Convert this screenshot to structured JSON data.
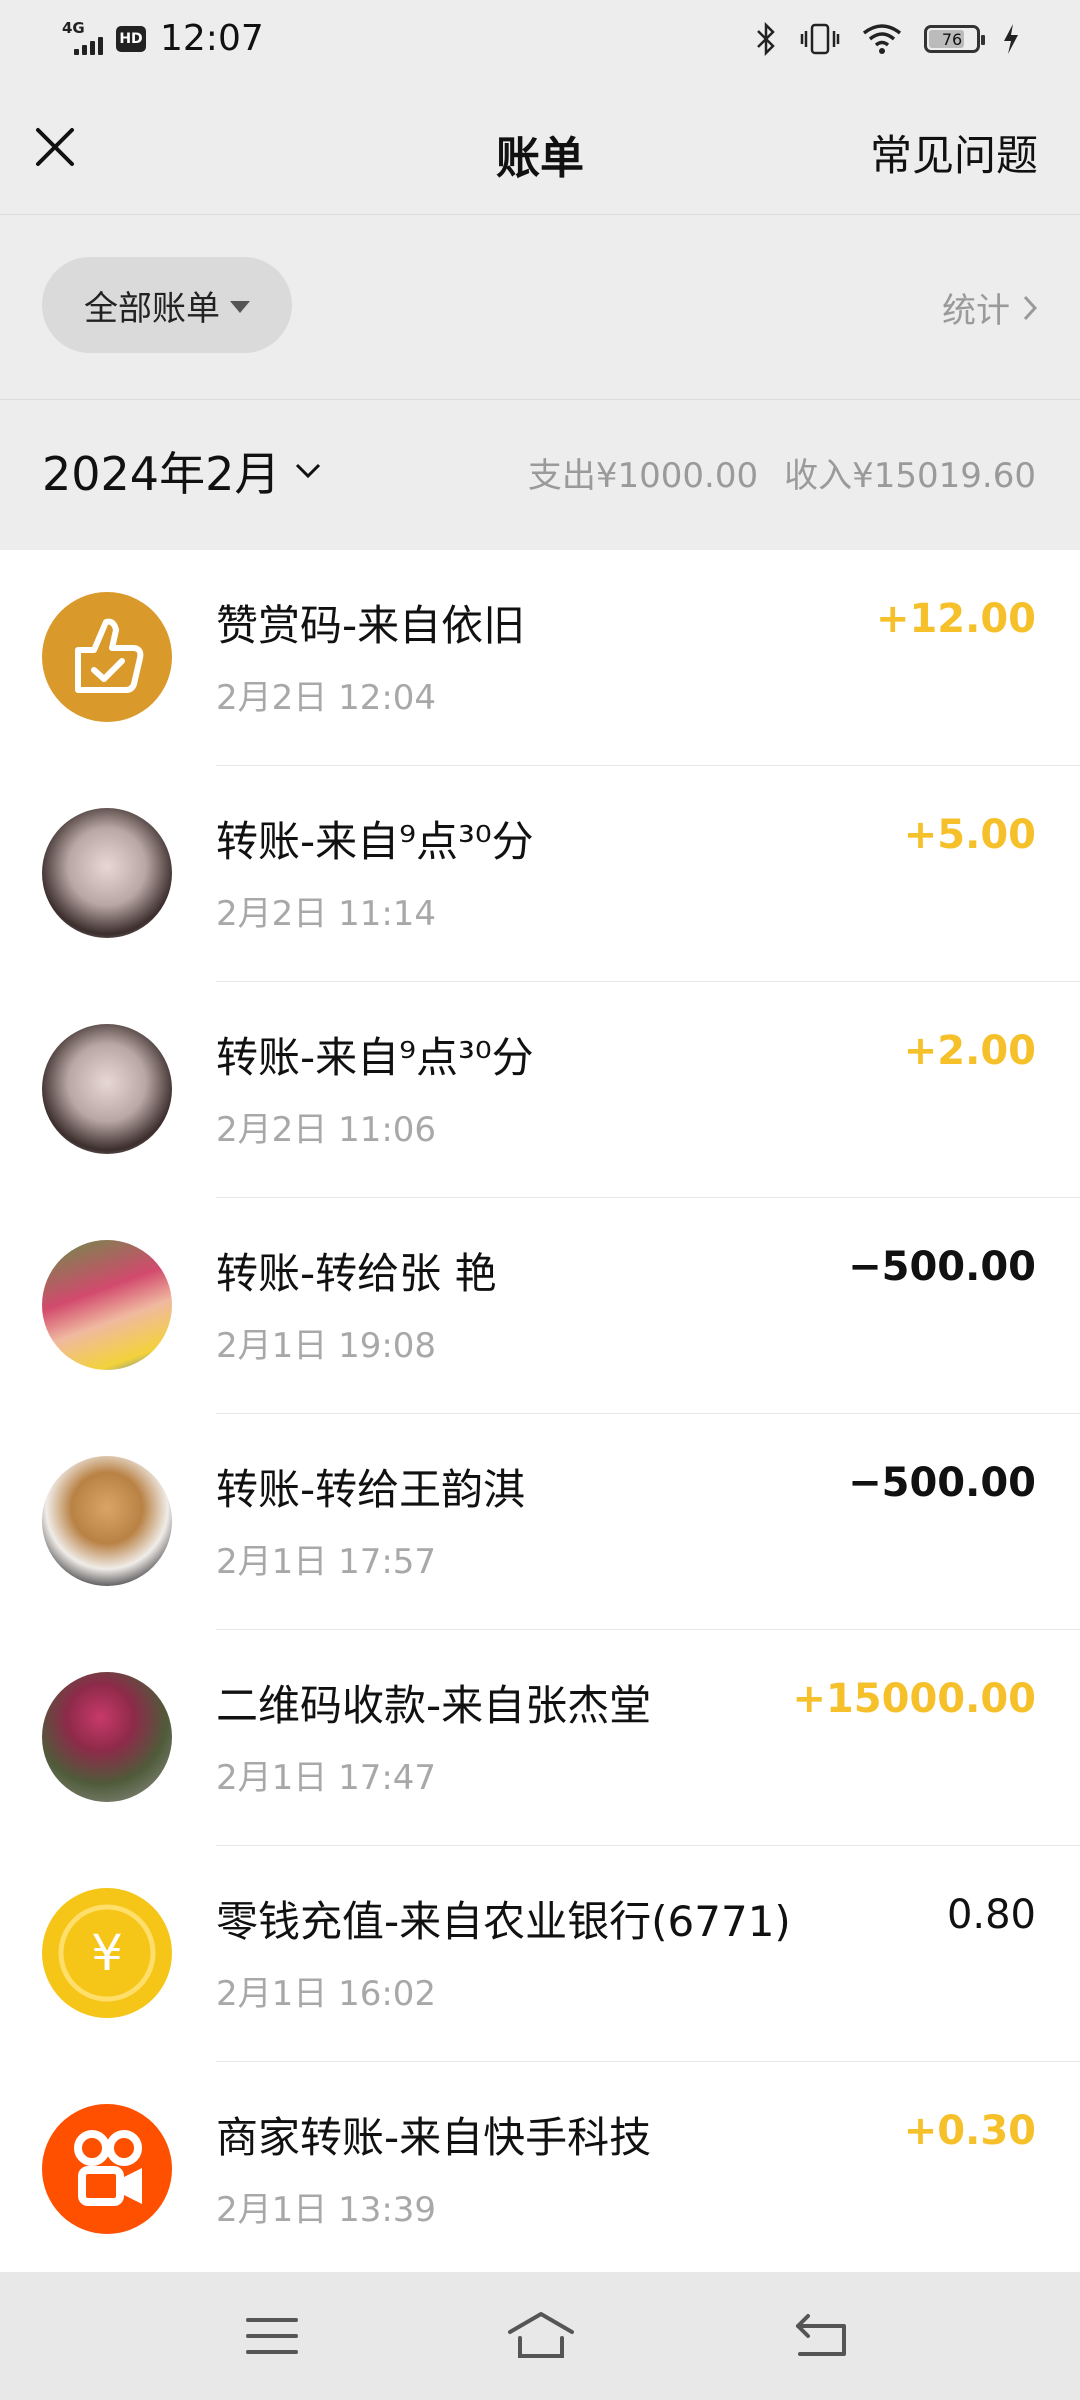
{
  "status_bar": {
    "network": "4G",
    "hd_label": "HD",
    "time": "12:07",
    "battery": "76",
    "battery_level": 0.76
  },
  "header": {
    "title": "账单",
    "right_link": "常见问题"
  },
  "filter": {
    "chip_label": "全部账单",
    "stats_label": "统计"
  },
  "month": {
    "label": "2024年2月",
    "expense": "支出¥1000.00",
    "income": "收入¥15019.60"
  },
  "transactions": [
    {
      "title": "赞赏码-来自依旧",
      "time": "2月2日 12:04",
      "amount": "+12.00",
      "avatar": "thumbs-up-icon",
      "avatar_color": "#d99a2b"
    },
    {
      "title": "转账-来自⁹点³⁰分",
      "time": "2月2日 11:14",
      "amount": "+5.00",
      "avatar": "user-photo"
    },
    {
      "title": "转账-来自⁹点³⁰分",
      "time": "2月2日 11:06",
      "amount": "+2.00",
      "avatar": "user-photo"
    },
    {
      "title": "转账-转给张 艳",
      "time": "2月1日 19:08",
      "amount": "−500.00",
      "avatar": "user-photo"
    },
    {
      "title": "转账-转给王韵淇",
      "time": "2月1日 17:57",
      "amount": "−500.00",
      "avatar": "dog-photo"
    },
    {
      "title": "二维码收款-来自张杰堂",
      "time": "2月1日 17:47",
      "amount": "+15000.00",
      "avatar": "flower-photo"
    },
    {
      "title": "零钱充值-来自农业银行(6771)",
      "time": "2月1日 16:02",
      "amount": "0.80",
      "avatar": "yuan-coin-icon",
      "coin_symbol": "¥",
      "avatar_color": "#f5c518"
    },
    {
      "title": "商家转账-来自快手科技",
      "time": "2月1日 13:39",
      "amount": "+0.30",
      "avatar": "kuaishou-logo",
      "avatar_color": "#ff5000"
    }
  ],
  "colors": {
    "positive": "#f5c02a",
    "background": "#ededed"
  }
}
